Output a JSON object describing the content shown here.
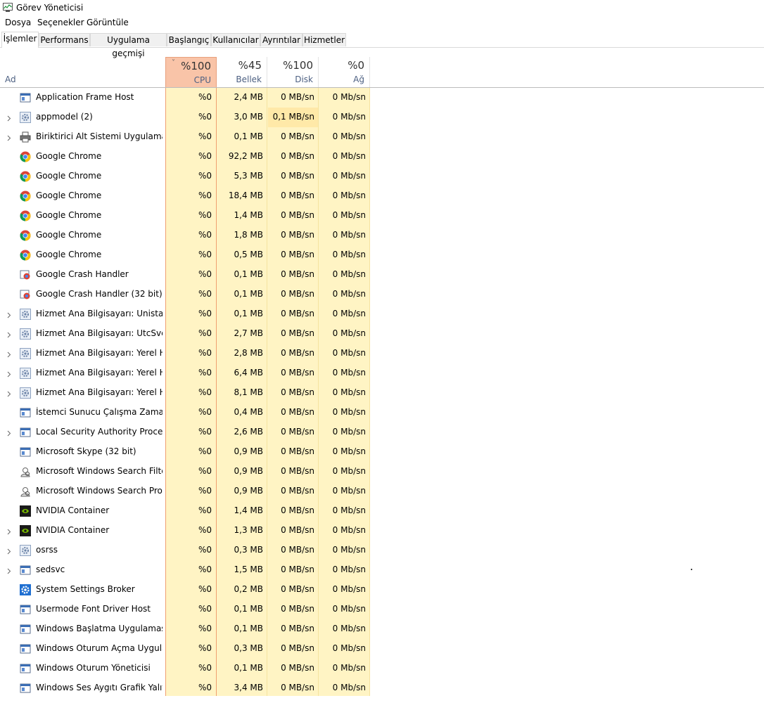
{
  "window": {
    "title": "Görev Yöneticisi"
  },
  "menu": [
    "Dosya",
    "Seçenekler",
    "Görüntüle"
  ],
  "tabs": [
    "İşlemler",
    "Performans",
    "Uygulama geçmişi",
    "Başlangıç",
    "Kullanıcılar",
    "Ayrıntılar",
    "Hizmetler"
  ],
  "active_tab": "İşlemler",
  "columns": {
    "name": "Ad",
    "cpu": {
      "pct": "%100",
      "label": "CPU"
    },
    "memory": {
      "pct": "%45",
      "label": "Bellek"
    },
    "disk": {
      "pct": "%100",
      "label": "Disk"
    },
    "network": {
      "pct": "%0",
      "label": "Ağ"
    }
  },
  "colors": {
    "cpu_header": "#f9c4a8",
    "cell_bg": "#fff4c4",
    "accent_border": "#f0a070"
  },
  "rows": [
    {
      "name": "Application Frame Host",
      "icon": "app-window-icon",
      "expandable": false,
      "cpu": "%0",
      "mem": "2,4 MB",
      "disk": "0 MB/sn",
      "net": "0 Mb/sn"
    },
    {
      "name": "appmodel (2)",
      "icon": "service-gear-icon",
      "expandable": true,
      "cpu": "%0",
      "mem": "3,0 MB",
      "disk": "0,1 MB/sn",
      "net": "0 Mb/sn",
      "disk_highlight": true
    },
    {
      "name": "Biriktirici Alt Sistemi Uygulaması",
      "icon": "printer-icon",
      "expandable": true,
      "cpu": "%0",
      "mem": "0,1 MB",
      "disk": "0 MB/sn",
      "net": "0 Mb/sn"
    },
    {
      "name": "Google Chrome",
      "icon": "chrome-icon",
      "expandable": false,
      "cpu": "%0",
      "mem": "92,2 MB",
      "disk": "0 MB/sn",
      "net": "0 Mb/sn"
    },
    {
      "name": "Google Chrome",
      "icon": "chrome-icon",
      "expandable": false,
      "cpu": "%0",
      "mem": "5,3 MB",
      "disk": "0 MB/sn",
      "net": "0 Mb/sn"
    },
    {
      "name": "Google Chrome",
      "icon": "chrome-icon",
      "expandable": false,
      "cpu": "%0",
      "mem": "18,4 MB",
      "disk": "0 MB/sn",
      "net": "0 Mb/sn"
    },
    {
      "name": "Google Chrome",
      "icon": "chrome-icon",
      "expandable": false,
      "cpu": "%0",
      "mem": "1,4 MB",
      "disk": "0 MB/sn",
      "net": "0 Mb/sn"
    },
    {
      "name": "Google Chrome",
      "icon": "chrome-icon",
      "expandable": false,
      "cpu": "%0",
      "mem": "1,8 MB",
      "disk": "0 MB/sn",
      "net": "0 Mb/sn"
    },
    {
      "name": "Google Chrome",
      "icon": "chrome-icon",
      "expandable": false,
      "cpu": "%0",
      "mem": "0,5 MB",
      "disk": "0 MB/sn",
      "net": "0 Mb/sn"
    },
    {
      "name": "Google Crash Handler",
      "icon": "crash-handler-icon",
      "expandable": false,
      "cpu": "%0",
      "mem": "0,1 MB",
      "disk": "0 MB/sn",
      "net": "0 Mb/sn"
    },
    {
      "name": "Google Crash Handler (32 bit)",
      "icon": "crash-handler-icon",
      "expandable": false,
      "cpu": "%0",
      "mem": "0,1 MB",
      "disk": "0 MB/sn",
      "net": "0 Mb/sn"
    },
    {
      "name": "Hizmet Ana Bilgisayarı: Unistac...",
      "icon": "service-gear-icon",
      "expandable": true,
      "cpu": "%0",
      "mem": "0,1 MB",
      "disk": "0 MB/sn",
      "net": "0 Mb/sn"
    },
    {
      "name": "Hizmet Ana Bilgisayarı: UtcSvc",
      "icon": "service-gear-icon",
      "expandable": true,
      "cpu": "%0",
      "mem": "2,7 MB",
      "disk": "0 MB/sn",
      "net": "0 Mb/sn"
    },
    {
      "name": "Hizmet Ana Bilgisayarı: Yerel Hi...",
      "icon": "service-gear-icon",
      "expandable": true,
      "cpu": "%0",
      "mem": "2,8 MB",
      "disk": "0 MB/sn",
      "net": "0 Mb/sn"
    },
    {
      "name": "Hizmet Ana Bilgisayarı: Yerel Hi...",
      "icon": "service-gear-icon",
      "expandable": true,
      "cpu": "%0",
      "mem": "6,4 MB",
      "disk": "0 MB/sn",
      "net": "0 Mb/sn"
    },
    {
      "name": "Hizmet Ana Bilgisayarı: Yerel Hi...",
      "icon": "service-gear-icon",
      "expandable": true,
      "cpu": "%0",
      "mem": "8,1 MB",
      "disk": "0 MB/sn",
      "net": "0 Mb/sn"
    },
    {
      "name": "İstemci Sunucu Çalışma Zaman...",
      "icon": "app-window-icon",
      "expandable": false,
      "cpu": "%0",
      "mem": "0,4 MB",
      "disk": "0 MB/sn",
      "net": "0 Mb/sn"
    },
    {
      "name": "Local Security Authority Proces...",
      "icon": "app-window-icon",
      "expandable": true,
      "cpu": "%0",
      "mem": "2,6 MB",
      "disk": "0 MB/sn",
      "net": "0 Mb/sn"
    },
    {
      "name": "Microsoft Skype (32 bit)",
      "icon": "app-window-icon",
      "expandable": false,
      "cpu": "%0",
      "mem": "0,9 MB",
      "disk": "0 MB/sn",
      "net": "0 Mb/sn"
    },
    {
      "name": "Microsoft Windows Search Filte...",
      "icon": "search-user-icon",
      "expandable": false,
      "cpu": "%0",
      "mem": "0,9 MB",
      "disk": "0 MB/sn",
      "net": "0 Mb/sn"
    },
    {
      "name": "Microsoft Windows Search Prot...",
      "icon": "search-user-icon",
      "expandable": false,
      "cpu": "%0",
      "mem": "0,9 MB",
      "disk": "0 MB/sn",
      "net": "0 Mb/sn"
    },
    {
      "name": "NVIDIA Container",
      "icon": "nvidia-icon",
      "expandable": false,
      "cpu": "%0",
      "mem": "1,4 MB",
      "disk": "0 MB/sn",
      "net": "0 Mb/sn"
    },
    {
      "name": "NVIDIA Container",
      "icon": "nvidia-icon",
      "expandable": true,
      "cpu": "%0",
      "mem": "1,3 MB",
      "disk": "0 MB/sn",
      "net": "0 Mb/sn"
    },
    {
      "name": "osrss",
      "icon": "service-gear-icon",
      "expandable": true,
      "cpu": "%0",
      "mem": "0,3 MB",
      "disk": "0 MB/sn",
      "net": "0 Mb/sn"
    },
    {
      "name": "sedsvc",
      "icon": "app-window-icon",
      "expandable": true,
      "cpu": "%0",
      "mem": "1,5 MB",
      "disk": "0 MB/sn",
      "net": "0 Mb/sn"
    },
    {
      "name": "System Settings Broker",
      "icon": "settings-gear-icon",
      "expandable": false,
      "cpu": "%0",
      "mem": "0,2 MB",
      "disk": "0 MB/sn",
      "net": "0 Mb/sn"
    },
    {
      "name": "Usermode Font Driver Host",
      "icon": "app-window-icon",
      "expandable": false,
      "cpu": "%0",
      "mem": "0,1 MB",
      "disk": "0 MB/sn",
      "net": "0 Mb/sn"
    },
    {
      "name": "Windows Başlatma Uygulaması",
      "icon": "app-window-icon",
      "expandable": false,
      "cpu": "%0",
      "mem": "0,1 MB",
      "disk": "0 MB/sn",
      "net": "0 Mb/sn"
    },
    {
      "name": "Windows Oturum Açma Uygula...",
      "icon": "app-window-icon",
      "expandable": false,
      "cpu": "%0",
      "mem": "0,3 MB",
      "disk": "0 MB/sn",
      "net": "0 Mb/sn"
    },
    {
      "name": "Windows Oturum Yöneticisi",
      "icon": "app-window-icon",
      "expandable": false,
      "cpu": "%0",
      "mem": "0,1 MB",
      "disk": "0 MB/sn",
      "net": "0 Mb/sn"
    },
    {
      "name": "Windows Ses Aygıtı Grafik Yalıtı...",
      "icon": "app-window-icon",
      "expandable": false,
      "cpu": "%0",
      "mem": "3,4 MB",
      "disk": "0 MB/sn",
      "net": "0 Mb/sn"
    }
  ]
}
